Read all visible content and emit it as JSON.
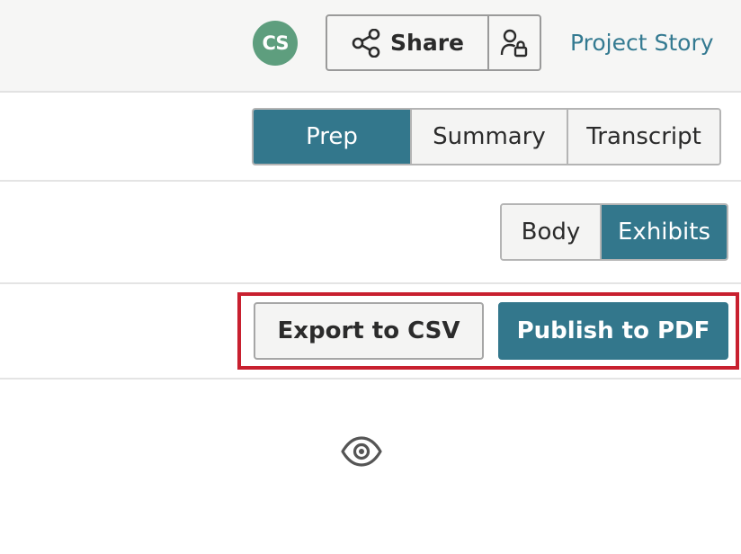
{
  "header": {
    "avatar_initials": "CS",
    "avatar_color": "#5e9e7e",
    "share_label": "Share",
    "share_icon": "share-icon",
    "access_icon": "user-lock-icon",
    "project_link": "Project Story",
    "link_color": "#347a91"
  },
  "view_tabs": {
    "options": [
      "Prep",
      "Summary",
      "Transcript"
    ],
    "selected": "Prep"
  },
  "content_tabs": {
    "options": [
      "Body",
      "Exhibits"
    ],
    "selected": "Exhibits"
  },
  "actions": {
    "export_label": "Export to CSV",
    "publish_label": "Publish to PDF",
    "highlight_color": "#c8202f"
  },
  "preview": {
    "icon": "eye-icon"
  },
  "colors": {
    "accent": "#33778c",
    "background": "#ffffff",
    "header_background": "#f6f6f5"
  }
}
